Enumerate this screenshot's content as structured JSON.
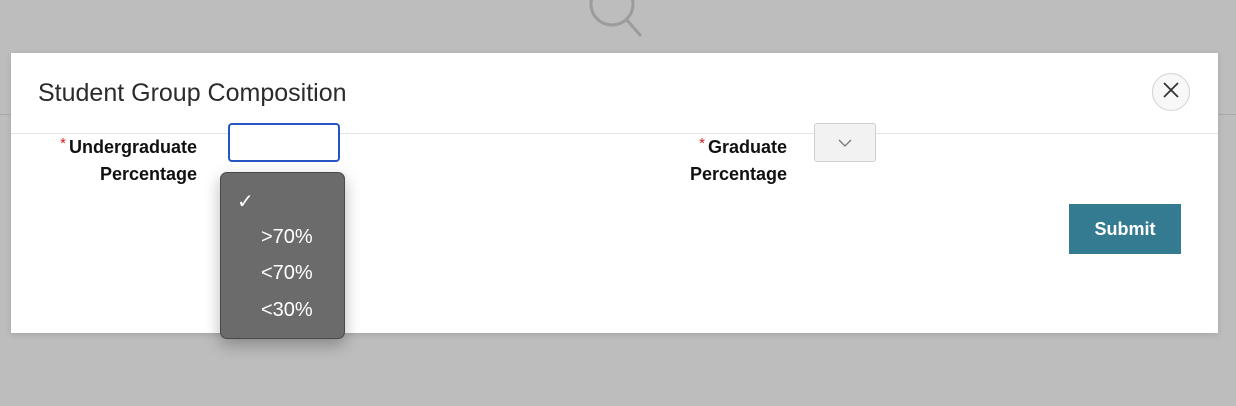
{
  "backdrop": {
    "icon": "search-icon"
  },
  "modal": {
    "title": "Student Group Composition",
    "close_icon": "close-icon"
  },
  "form": {
    "undergraduate": {
      "required_mark": "*",
      "label_line1": "Undergraduate",
      "label_line2": "Percentage",
      "selected_value": "",
      "dropdown_open": true,
      "options": [
        {
          "label": "",
          "selected": true,
          "check_mark": "✓"
        },
        {
          "label": ">70%",
          "selected": false
        },
        {
          "label": "<70%",
          "selected": false
        },
        {
          "label": "<30%",
          "selected": false
        }
      ]
    },
    "graduate": {
      "required_mark": "*",
      "label_line1": "Graduate",
      "label_line2": "Percentage",
      "selected_value": "",
      "chevron_icon": "chevron-down-icon"
    },
    "submit_label": "Submit"
  },
  "colors": {
    "submit_bg": "#347b92",
    "required": "#d01c1c",
    "focus_border": "#2455c3",
    "dropdown_bg": "#6b6b6b",
    "overlay": "#bdbdbd"
  }
}
